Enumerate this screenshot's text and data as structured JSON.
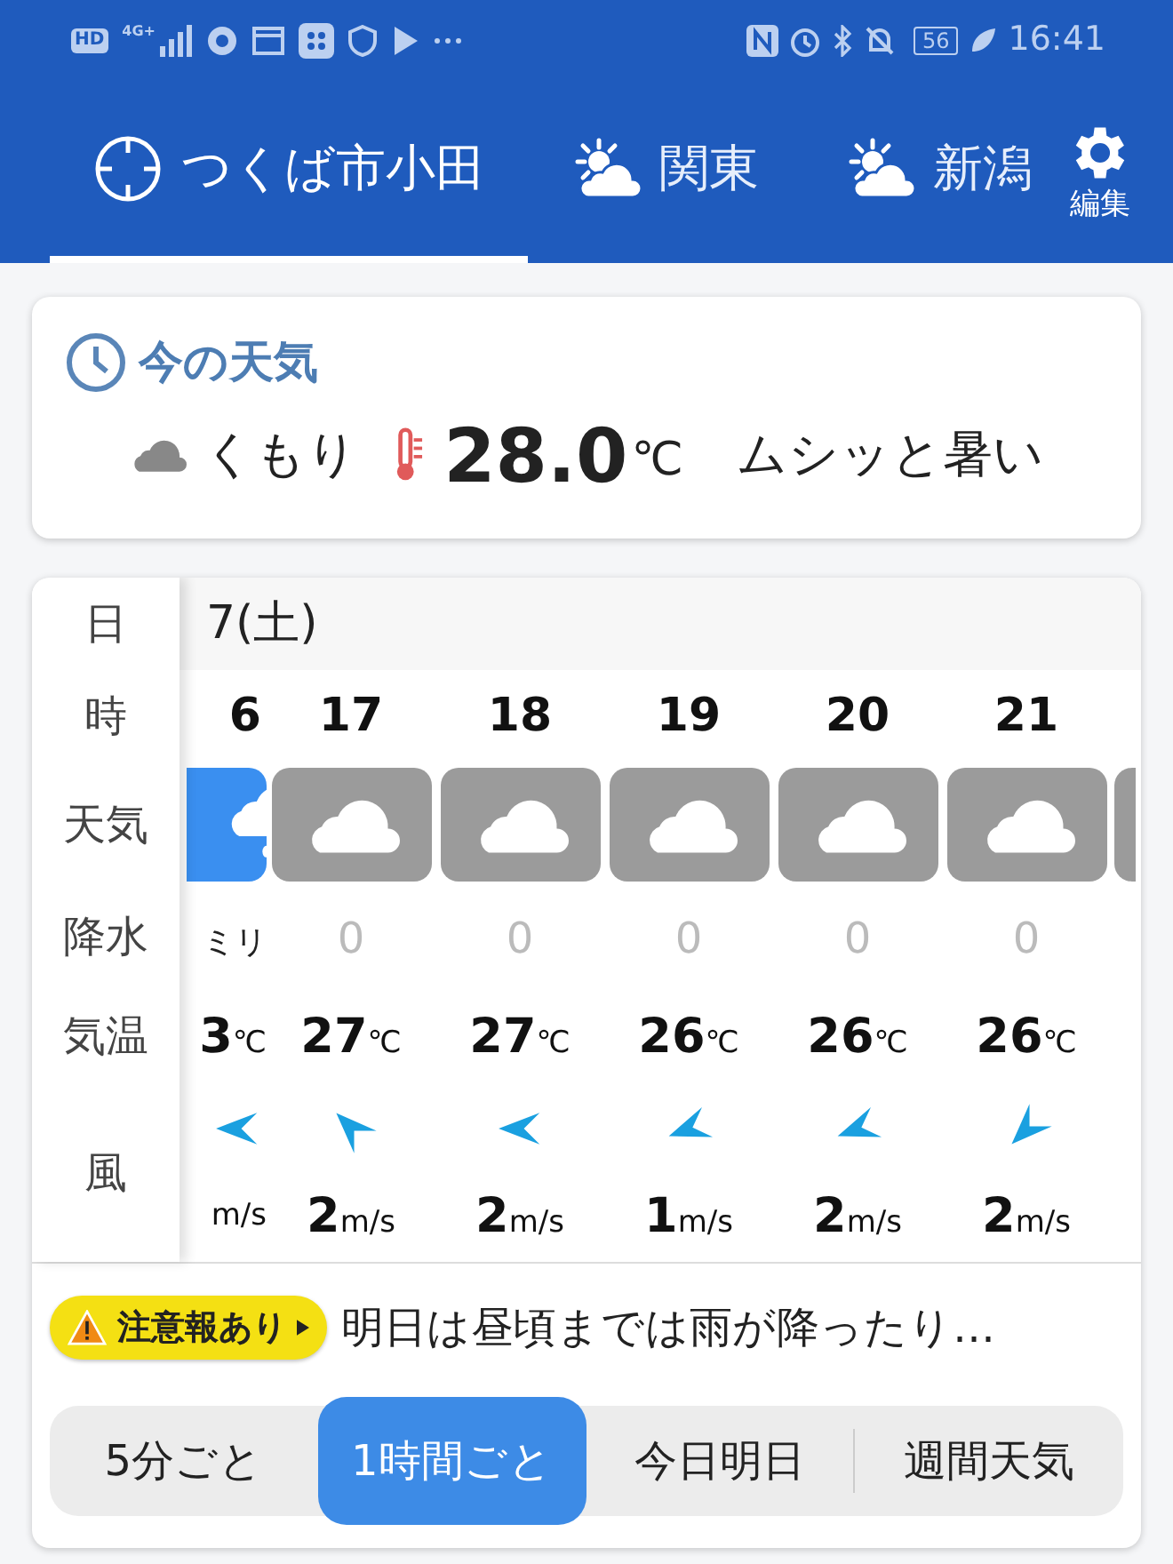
{
  "status_bar": {
    "hd": "HD",
    "network": "4G+",
    "battery": "56",
    "time": "16:41"
  },
  "tabs": [
    {
      "kind": "location",
      "label": "つくば市小田",
      "selected": true
    },
    {
      "kind": "sun-cloud",
      "label": "関東",
      "selected": false
    },
    {
      "kind": "sun-cloud",
      "label": "新潟",
      "selected": false
    }
  ],
  "edit_button": "編集",
  "current": {
    "title": "今の天気",
    "condition": "くもり",
    "temperature": "28.0",
    "unit": "℃",
    "feeling": "ムシッと暑い"
  },
  "hourly": {
    "labels": {
      "date": "日",
      "hour": "時",
      "weather": "天気",
      "precip": "降水",
      "temp": "気温",
      "wind": "風"
    },
    "date": "7(土)",
    "columns": [
      {
        "partial": true,
        "hour": "6",
        "weather": {
          "kind": "rain"
        },
        "precip": {
          "unit": "ミリ"
        },
        "temp": {
          "value": "3",
          "unit": "℃"
        },
        "wind": {
          "kind": "w",
          "unit": "m/s"
        }
      },
      {
        "partial": false,
        "hour": "17",
        "weather": {
          "kind": "cloudy"
        },
        "precip": {
          "value": "0"
        },
        "temp": {
          "value": "27",
          "unit": "℃"
        },
        "wind": {
          "kind": "nw",
          "value": "2",
          "unit": "m/s"
        }
      },
      {
        "partial": false,
        "hour": "18",
        "weather": {
          "kind": "cloudy"
        },
        "precip": {
          "value": "0"
        },
        "temp": {
          "value": "27",
          "unit": "℃"
        },
        "wind": {
          "kind": "w",
          "value": "2",
          "unit": "m/s"
        }
      },
      {
        "partial": false,
        "hour": "19",
        "weather": {
          "kind": "cloudy"
        },
        "precip": {
          "value": "0"
        },
        "temp": {
          "value": "26",
          "unit": "℃"
        },
        "wind": {
          "kind": "wsw",
          "value": "1",
          "unit": "m/s"
        }
      },
      {
        "partial": false,
        "hour": "20",
        "weather": {
          "kind": "cloudy"
        },
        "precip": {
          "value": "0"
        },
        "temp": {
          "value": "26",
          "unit": "℃"
        },
        "wind": {
          "kind": "wsw",
          "value": "2",
          "unit": "m/s"
        }
      },
      {
        "partial": false,
        "hour": "21",
        "weather": {
          "kind": "cloudy"
        },
        "precip": {
          "value": "0"
        },
        "temp": {
          "value": "26",
          "unit": "℃"
        },
        "wind": {
          "kind": "sw",
          "value": "2",
          "unit": "m/s"
        }
      },
      {
        "partial": true,
        "weather": {
          "kind": "cloudy"
        }
      }
    ]
  },
  "alert": {
    "badge": "注意報あり",
    "text": "明日は昼頃までは雨が降ったり…"
  },
  "modes": [
    {
      "label": "5分ごと",
      "selected": false
    },
    {
      "label": "1時間ごと",
      "selected": true
    },
    {
      "label": "今日明日",
      "selected": false
    },
    {
      "label": "週間天気",
      "selected": false
    }
  ]
}
